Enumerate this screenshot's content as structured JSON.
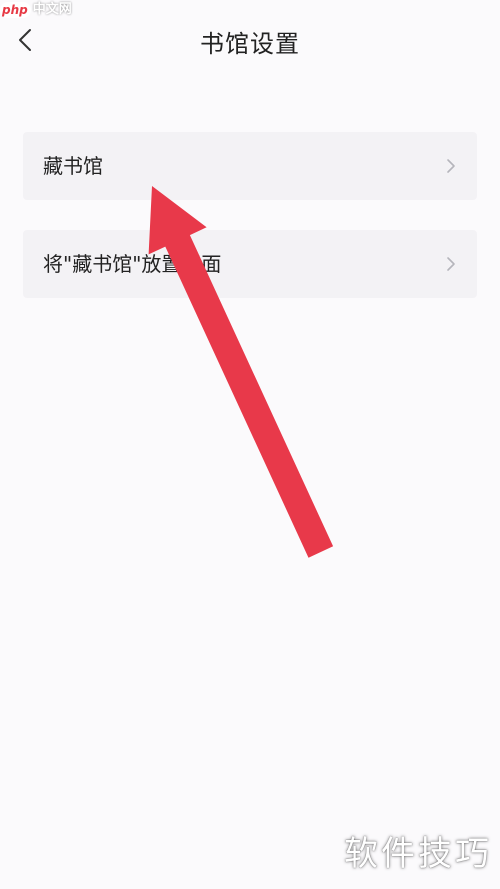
{
  "watermark_top": {
    "brand": "php",
    "site": "中文网"
  },
  "header": {
    "title": "书馆设置",
    "back_icon": "chevron-left-icon"
  },
  "settings": [
    {
      "label": "藏书馆",
      "icon": "chevron-right-icon"
    },
    {
      "label": "将\"藏书馆\"放置桌面",
      "icon": "chevron-right-icon"
    }
  ],
  "annotation": {
    "arrow_color": "#e8394a",
    "arrow_icon": "red-arrow-icon"
  },
  "watermark_bottom": "软件技巧"
}
